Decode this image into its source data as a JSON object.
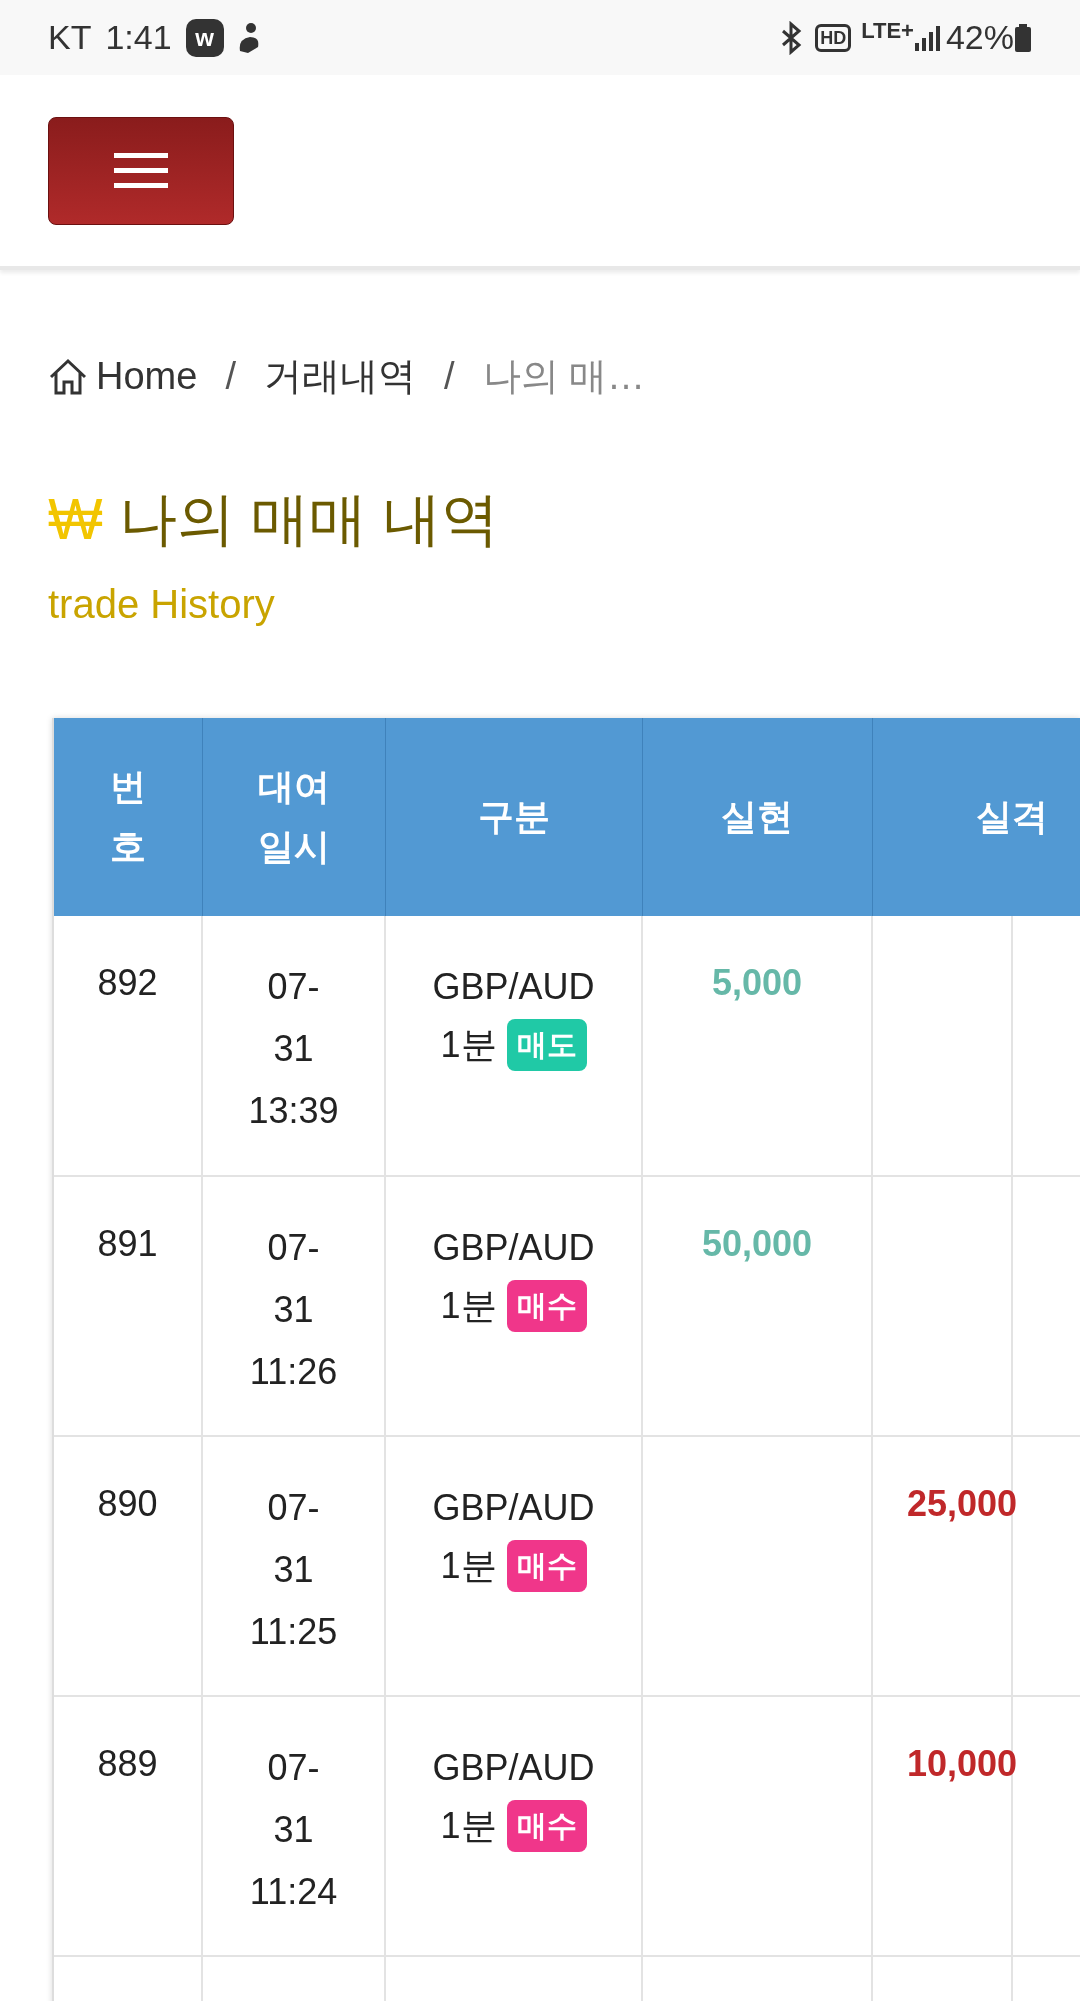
{
  "status_bar": {
    "carrier": "KT",
    "time": "1:41",
    "app_badge": "w",
    "hd": "HD",
    "network": "LTE+",
    "battery": "42%"
  },
  "breadcrumb": [
    {
      "label": "Home",
      "kind": "home"
    },
    {
      "separator": "/",
      "label": "거래내역",
      "kind": "link"
    },
    {
      "separator": "/",
      "label": "나의 매…",
      "kind": "current"
    }
  ],
  "title": {
    "icon": "₩",
    "text": "나의 매매 내역",
    "subtitle": "trade History"
  },
  "table": {
    "columns": [
      "번\n호",
      "대여\n일시",
      "구분",
      "실현",
      "실격"
    ],
    "rows": [
      {
        "number": "892",
        "date": "07-\n31\n13:39",
        "pair": "GBP/AUD",
        "period": "1분",
        "type": {
          "label": "매도",
          "kind": "sell"
        },
        "realized": "5,000"
      },
      {
        "number": "891",
        "date": "07-\n31\n11:26",
        "pair": "GBP/AUD",
        "period": "1분",
        "type": {
          "label": "매수",
          "kind": "buy"
        },
        "realized": "50,000"
      },
      {
        "number": "890",
        "date": "07-\n31\n11:25",
        "pair": "GBP/AUD",
        "period": "1분",
        "type": {
          "label": "매수",
          "kind": "buy"
        },
        "loss": "25,000"
      },
      {
        "number": "889",
        "date": "07-\n31\n11:24",
        "pair": "GBP/AUD",
        "period": "1분",
        "type": {
          "label": "매수",
          "kind": "buy"
        },
        "loss": "10,000"
      }
    ]
  }
}
